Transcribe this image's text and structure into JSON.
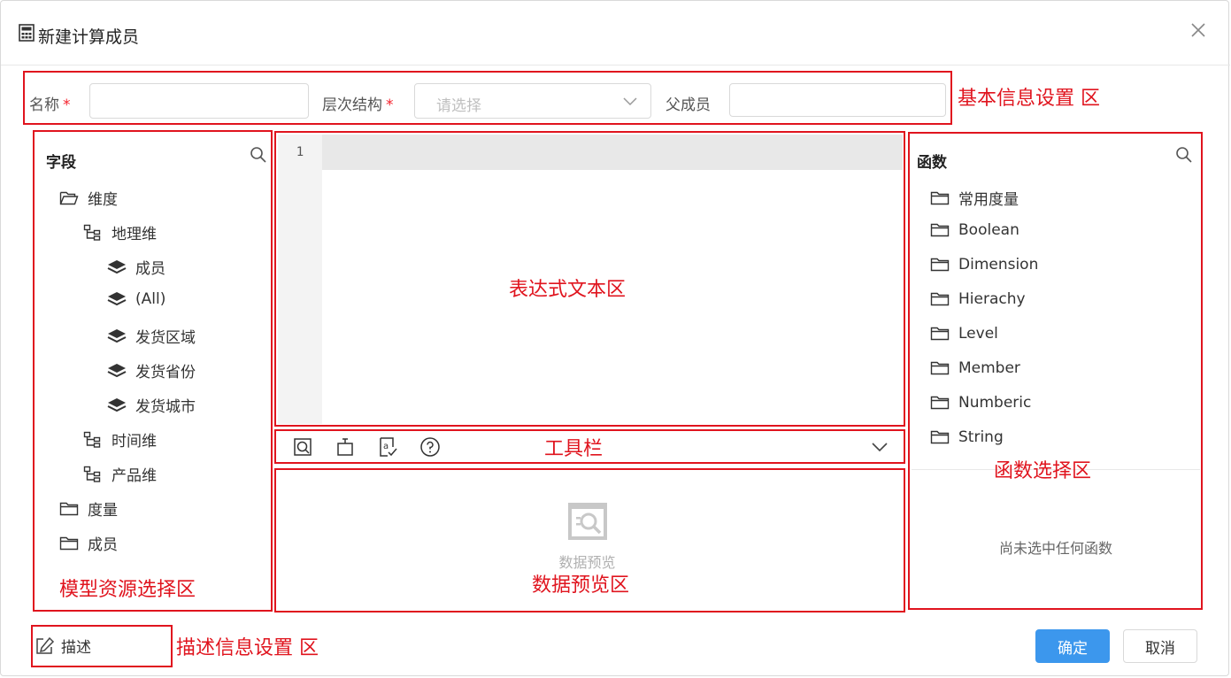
{
  "dialog": {
    "title": "新建计算成员",
    "title_icon": "calculator-icon",
    "close_icon": "close-icon"
  },
  "basic_info": {
    "name_label": "名称",
    "hierarchy_label": "层次结构",
    "hierarchy_placeholder": "请选择",
    "parent_label": "父成员",
    "required_mark": "*",
    "name_value": "",
    "parent_value": ""
  },
  "fields_panel": {
    "title": "字段",
    "search_icon": "search-icon",
    "tree": [
      {
        "label": "维度",
        "icon": "folder-open-icon"
      },
      {
        "label": "地理维",
        "icon": "hierarchy-icon"
      },
      {
        "label": "成员",
        "icon": "layers-icon"
      },
      {
        "label": "(All)",
        "icon": "layers-icon"
      },
      {
        "label": "发货区域",
        "icon": "layers-icon"
      },
      {
        "label": "发货省份",
        "icon": "layers-icon"
      },
      {
        "label": "发货城市",
        "icon": "layers-icon"
      },
      {
        "label": "时间维",
        "icon": "hierarchy-icon"
      },
      {
        "label": "产品维",
        "icon": "hierarchy-icon"
      },
      {
        "label": "度量",
        "icon": "folder-icon"
      },
      {
        "label": "成员",
        "icon": "folder-icon"
      }
    ]
  },
  "editor": {
    "line_number": "1",
    "content": ""
  },
  "toolbar": {
    "icons": [
      "preview-icon",
      "format-icon",
      "validate-icon",
      "help-icon"
    ],
    "expand_icon": "chevron-down-icon"
  },
  "preview": {
    "empty_icon": "data-preview-icon",
    "empty_text": "数据预览"
  },
  "functions_panel": {
    "title": "函数",
    "search_icon": "search-icon",
    "categories": [
      "常用度量",
      "Boolean",
      "Dimension",
      "Hierachy",
      "Level",
      "Member",
      "Numberic",
      "String"
    ],
    "empty_text": "尚未选中任何函数"
  },
  "footer": {
    "description_label": "描述",
    "description_icon": "edit-icon",
    "ok_label": "确定",
    "cancel_label": "取消"
  },
  "annotations": {
    "basic_info": "基本信息设置 区",
    "model_resource": "模型资源选择区",
    "expression": "表达式文本区",
    "toolbar": "工具栏",
    "data_preview": "数据预览区",
    "function_select": "函数选择区",
    "description": "描述信息设置 区",
    "color": "#e0141e"
  }
}
